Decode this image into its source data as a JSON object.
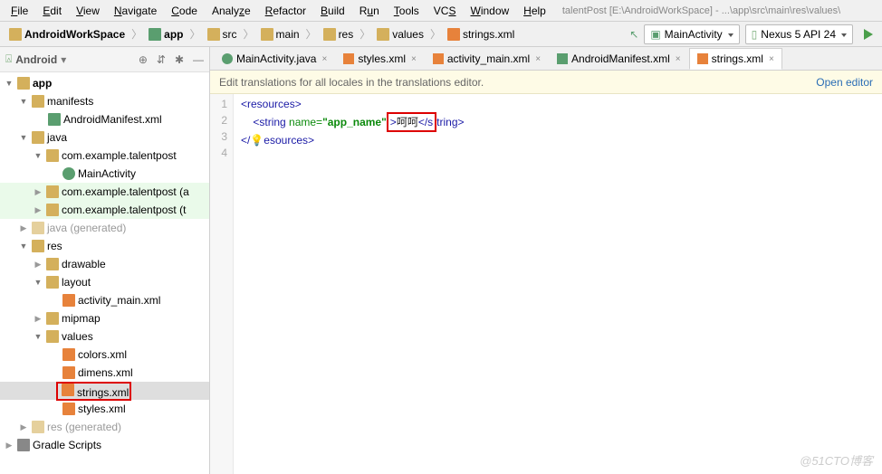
{
  "menu": {
    "items": [
      "File",
      "Edit",
      "View",
      "Navigate",
      "Code",
      "Analyze",
      "Refactor",
      "Build",
      "Run",
      "Tools",
      "VCS",
      "Window",
      "Help"
    ],
    "title": "talentPost [E:\\AndroidWorkSpace] - ...\\app\\src\\main\\res\\values\\"
  },
  "breadcrumbs": [
    {
      "icon": "folder",
      "label": "AndroidWorkSpace",
      "bold": true
    },
    {
      "icon": "mod",
      "label": "app",
      "bold": true
    },
    {
      "icon": "folder",
      "label": "src"
    },
    {
      "icon": "folder",
      "label": "main"
    },
    {
      "icon": "folder",
      "label": "res"
    },
    {
      "icon": "folder",
      "label": "values"
    },
    {
      "icon": "xml",
      "label": "strings.xml"
    }
  ],
  "runconfig": {
    "main": "MainActivity",
    "device": "Nexus 5 API 24"
  },
  "sidebar": {
    "title": "Android",
    "chevron": "▾"
  },
  "tree": {
    "app": "app",
    "manifests": "manifests",
    "manifest_file": "AndroidManifest.xml",
    "java": "java",
    "pkg1": "com.example.talentpost",
    "mainact": "MainActivity",
    "pkg2": "com.example.talentpost (a",
    "pkg3": "com.example.talentpost (t",
    "javagen": "java (generated)",
    "res": "res",
    "drawable": "drawable",
    "layout": "layout",
    "actmain": "activity_main.xml",
    "mipmap": "mipmap",
    "values": "values",
    "colors": "colors.xml",
    "dimens": "dimens.xml",
    "strings": "strings.xml",
    "styles": "styles.xml",
    "resgen": "res (generated)",
    "gradle": "Gradle Scripts"
  },
  "tabs": [
    {
      "icon": "java",
      "label": "MainActivity.java",
      "active": false
    },
    {
      "icon": "xml",
      "label": "styles.xml",
      "active": false
    },
    {
      "icon": "xml",
      "label": "activity_main.xml",
      "active": false
    },
    {
      "icon": "mf",
      "label": "AndroidManifest.xml",
      "active": false
    },
    {
      "icon": "xml",
      "label": "strings.xml",
      "active": true
    }
  ],
  "banner": {
    "text": "Edit translations for all locales in the translations editor.",
    "link": "Open editor"
  },
  "code": {
    "lines": [
      "1",
      "2",
      "3",
      "4"
    ],
    "l1_open": "<",
    "l1_tag": "resources",
    "l1_close": ">",
    "l2_open": "<",
    "l2_tag": "string",
    "l2_attr": " name=",
    "l2_val": "\"app_name\"",
    "l2_mid": ">",
    "l2_text": "呵呵",
    "l2_end_open": "</s",
    "l2_end_tag": "tring",
    "l2_end_close": ">",
    "l3_open": "</",
    "l3_tag": "esources",
    "l3_close": ">"
  },
  "watermark": "@51CTO博客"
}
